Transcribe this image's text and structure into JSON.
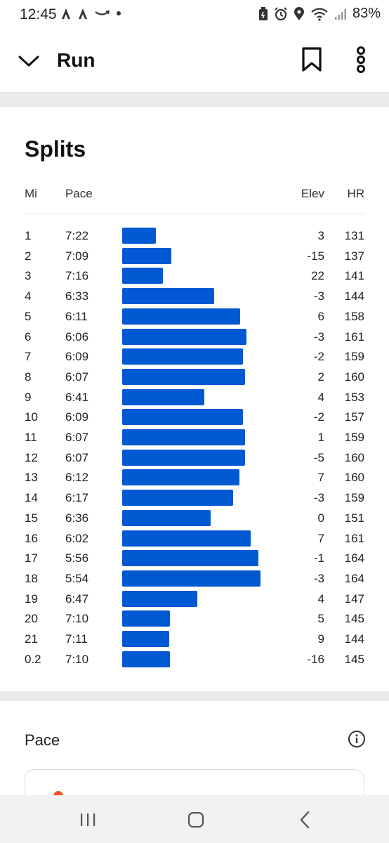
{
  "status_bar": {
    "time": "12:45",
    "battery": "83%",
    "left_icons": [
      "strava-icon",
      "strava-icon",
      "amazon-icon",
      "dot-icon"
    ],
    "right_icons": [
      "battery-saver-icon",
      "alarm-icon",
      "location-icon",
      "wifi-icon",
      "signal-icon"
    ]
  },
  "header": {
    "title": "Run",
    "back_icon": "chevron-down-icon",
    "bookmark_icon": "bookmark-icon",
    "more_icon": "more-vertical-icon"
  },
  "splits": {
    "title": "Splits",
    "columns": {
      "mi": "Mi",
      "pace": "Pace",
      "elev": "Elev",
      "hr": "HR"
    },
    "bar_color": "#0059d3",
    "rows": [
      {
        "mi": "1",
        "pace": "7:22",
        "elev": "3",
        "hr": "131"
      },
      {
        "mi": "2",
        "pace": "7:09",
        "elev": "-15",
        "hr": "137"
      },
      {
        "mi": "3",
        "pace": "7:16",
        "elev": "22",
        "hr": "141"
      },
      {
        "mi": "4",
        "pace": "6:33",
        "elev": "-3",
        "hr": "144"
      },
      {
        "mi": "5",
        "pace": "6:11",
        "elev": "6",
        "hr": "158"
      },
      {
        "mi": "6",
        "pace": "6:06",
        "elev": "-3",
        "hr": "161"
      },
      {
        "mi": "7",
        "pace": "6:09",
        "elev": "-2",
        "hr": "159"
      },
      {
        "mi": "8",
        "pace": "6:07",
        "elev": "2",
        "hr": "160"
      },
      {
        "mi": "9",
        "pace": "6:41",
        "elev": "4",
        "hr": "153"
      },
      {
        "mi": "10",
        "pace": "6:09",
        "elev": "-2",
        "hr": "157"
      },
      {
        "mi": "11",
        "pace": "6:07",
        "elev": "1",
        "hr": "159"
      },
      {
        "mi": "12",
        "pace": "6:07",
        "elev": "-5",
        "hr": "160"
      },
      {
        "mi": "13",
        "pace": "6:12",
        "elev": "7",
        "hr": "160"
      },
      {
        "mi": "14",
        "pace": "6:17",
        "elev": "-3",
        "hr": "159"
      },
      {
        "mi": "15",
        "pace": "6:36",
        "elev": "0",
        "hr": "151"
      },
      {
        "mi": "16",
        "pace": "6:02",
        "elev": "7",
        "hr": "161"
      },
      {
        "mi": "17",
        "pace": "5:56",
        "elev": "-1",
        "hr": "164"
      },
      {
        "mi": "18",
        "pace": "5:54",
        "elev": "-3",
        "hr": "164"
      },
      {
        "mi": "19",
        "pace": "6:47",
        "elev": "4",
        "hr": "147"
      },
      {
        "mi": "20",
        "pace": "7:10",
        "elev": "5",
        "hr": "145"
      },
      {
        "mi": "21",
        "pace": "7:11",
        "elev": "9",
        "hr": "144"
      },
      {
        "mi": "0.2",
        "pace": "7:10",
        "elev": "-16",
        "hr": "145"
      }
    ]
  },
  "pace_section": {
    "title": "Pace",
    "info_icon": "info-icon",
    "accent_color": "#ee5a24"
  },
  "nav_bar": {
    "recents_icon": "recents-icon",
    "home_icon": "home-icon",
    "back_icon": "back-icon"
  }
}
